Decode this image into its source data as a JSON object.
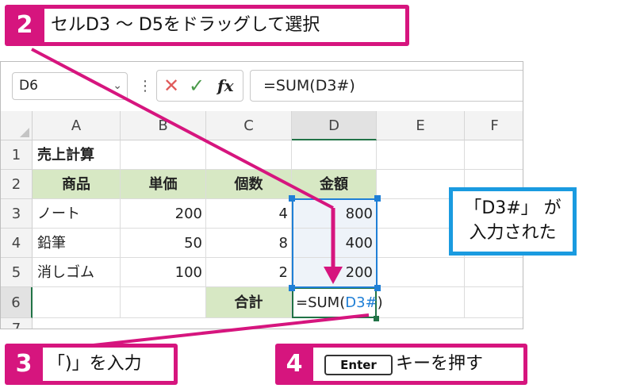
{
  "step2": {
    "num": "2",
    "text": "セルD3 〜 D5をドラッグして選択"
  },
  "step3": {
    "num": "3",
    "text": "「)」を入力"
  },
  "step4": {
    "num": "4",
    "key": "Enter",
    "text": "キーを押す"
  },
  "note": {
    "line1": "「D3#」 が",
    "line2": "入力された"
  },
  "formula_bar": {
    "name_box": "D6",
    "formula": "=SUM(D3#)"
  },
  "columns": [
    "A",
    "B",
    "C",
    "D",
    "E",
    "F"
  ],
  "rows": [
    "1",
    "2",
    "3",
    "4",
    "5",
    "6",
    "7"
  ],
  "sheet": {
    "title": "売上計算",
    "headers": [
      "商品",
      "単価",
      "個数",
      "金額"
    ],
    "data": [
      [
        "ノート",
        "200",
        "4",
        "800"
      ],
      [
        "鉛筆",
        "50",
        "8",
        "400"
      ],
      [
        "消しゴム",
        "100",
        "2",
        "200"
      ]
    ],
    "total_label": "合計",
    "edit_prefix": "=SUM(",
    "edit_ref": "D3#",
    "edit_suffix": ")"
  },
  "colors": {
    "accent_pink": "#d6157e",
    "callout_blue": "#1a9be0",
    "header_green": "#d7e8c4",
    "ref_blue": "#1f7fd6",
    "selection_green": "#217346"
  }
}
